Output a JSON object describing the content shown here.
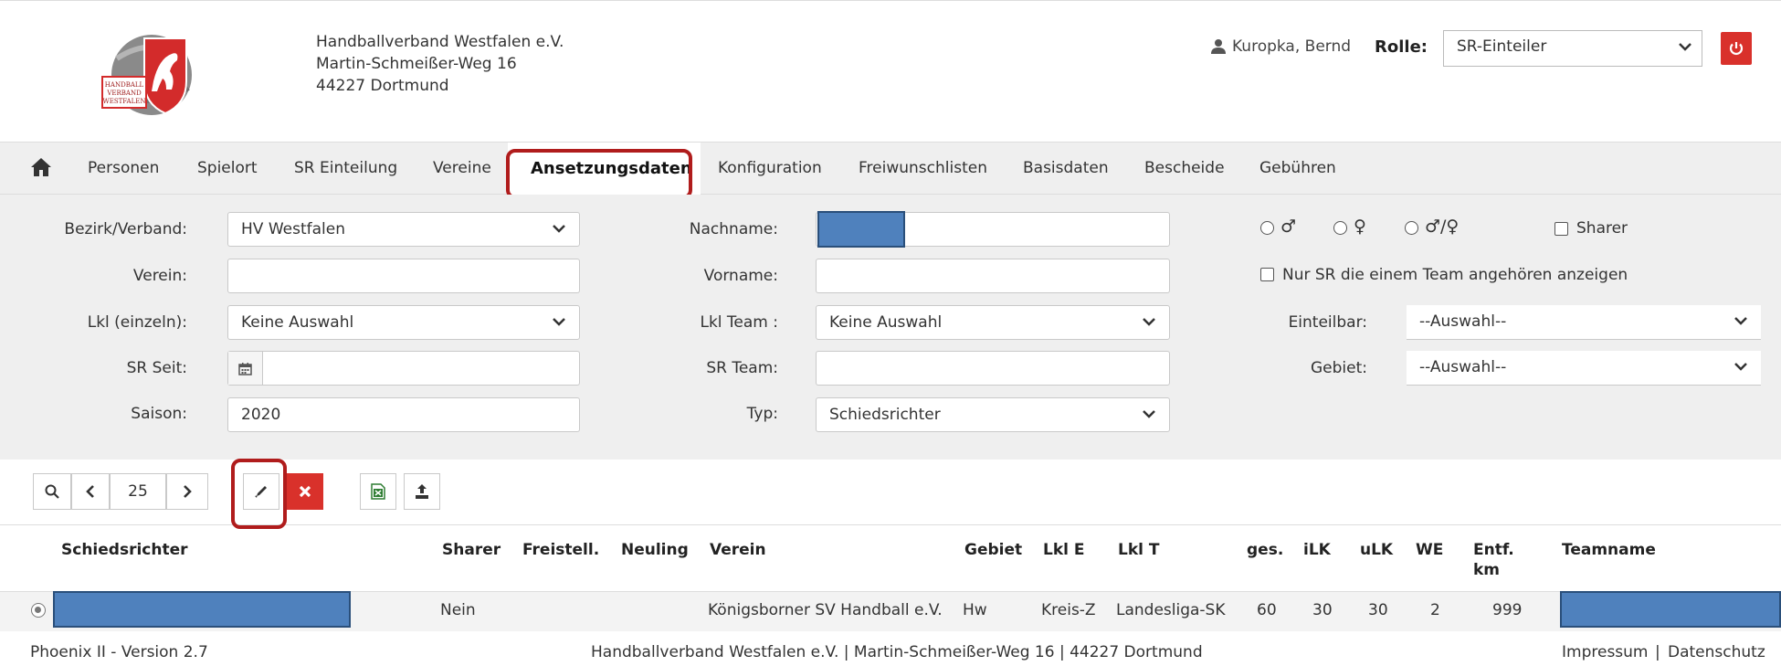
{
  "org": {
    "name": "Handballverband Westfalen e.V.",
    "street": "Martin-Schmeißer-Weg 16",
    "city": "44227 Dortmund",
    "logo_text": [
      "HANDBALL",
      "VERBAND",
      "WESTFALEN"
    ]
  },
  "user": {
    "name": "Kuropka, Bernd",
    "role_label": "Rolle:",
    "role_value": "SR-Einteiler"
  },
  "nav": {
    "items": [
      "Personen",
      "Spielort",
      "SR Einteilung",
      "Vereine",
      "Ansetzungsdaten",
      "Konfiguration",
      "Freiwunschlisten",
      "Basisdaten",
      "Bescheide",
      "Gebühren"
    ],
    "active": "Ansetzungsdaten"
  },
  "filters": {
    "bezirk_label": "Bezirk/Verband:",
    "bezirk_value": "HV Westfalen",
    "verein_label": "Verein:",
    "verein_value": "",
    "lkl_einzeln_label": "Lkl (einzeln):",
    "lkl_einzeln_value": "Keine Auswahl",
    "sr_seit_label": "SR Seit:",
    "sr_seit_value": "",
    "saison_label": "Saison:",
    "saison_value": "2020",
    "nachname_label": "Nachname:",
    "vorname_label": "Vorname:",
    "vorname_value": "",
    "lkl_team_label": "Lkl Team :",
    "lkl_team_value": "Keine Auswahl",
    "sr_team_label": "SR Team:",
    "sr_team_value": "",
    "typ_label": "Typ:",
    "typ_value": "Schiedsrichter",
    "gender_male": "♂",
    "gender_female": "♀",
    "gender_both": "♂/♀",
    "sharer_label": "Sharer",
    "nur_sr_label": "Nur SR die einem Team angehören anzeigen",
    "einteilbar_label": "Einteilbar:",
    "einteilbar_value": "--Auswahl--",
    "gebiet_label": "Gebiet:",
    "gebiet_value": "--Auswahl--"
  },
  "toolbar": {
    "page_size": "25"
  },
  "table": {
    "headers": {
      "schiedsrichter": "Schiedsrichter",
      "sharer": "Sharer",
      "freistell": "Freistell.",
      "neuling": "Neuling",
      "verein": "Verein",
      "gebiet": "Gebiet",
      "lkl_e": "Lkl E",
      "lkl_t": "Lkl T",
      "ges": "ges.",
      "ilk": "iLK",
      "ulk": "uLK",
      "we": "WE",
      "entf_1": "Entf.",
      "entf_2": "km",
      "teamname": "Teamname"
    },
    "row": {
      "sharer": "Nein",
      "verein": "Königsborner SV Handball e.V.",
      "gebiet": "Hw",
      "lkl_e": "Kreis-Z",
      "lkl_t": "Landesliga-SK",
      "ges": "60",
      "ilk": "30",
      "ulk": "30",
      "we": "2",
      "entf": "999"
    }
  },
  "footer": {
    "version": "Phoenix II - Version 2.7",
    "address": "Handballverband Westfalen e.V. | Martin-Schmeißer-Weg 16 | 44227 Dortmund",
    "impressum": "Impressum",
    "separator": "|",
    "datenschutz": "Datenschutz"
  },
  "colors": {
    "accent_red": "#d9312b",
    "highlight_red": "#b01c1c",
    "redaction_blue": "#4f81bd",
    "panel_gray": "#efefef"
  }
}
